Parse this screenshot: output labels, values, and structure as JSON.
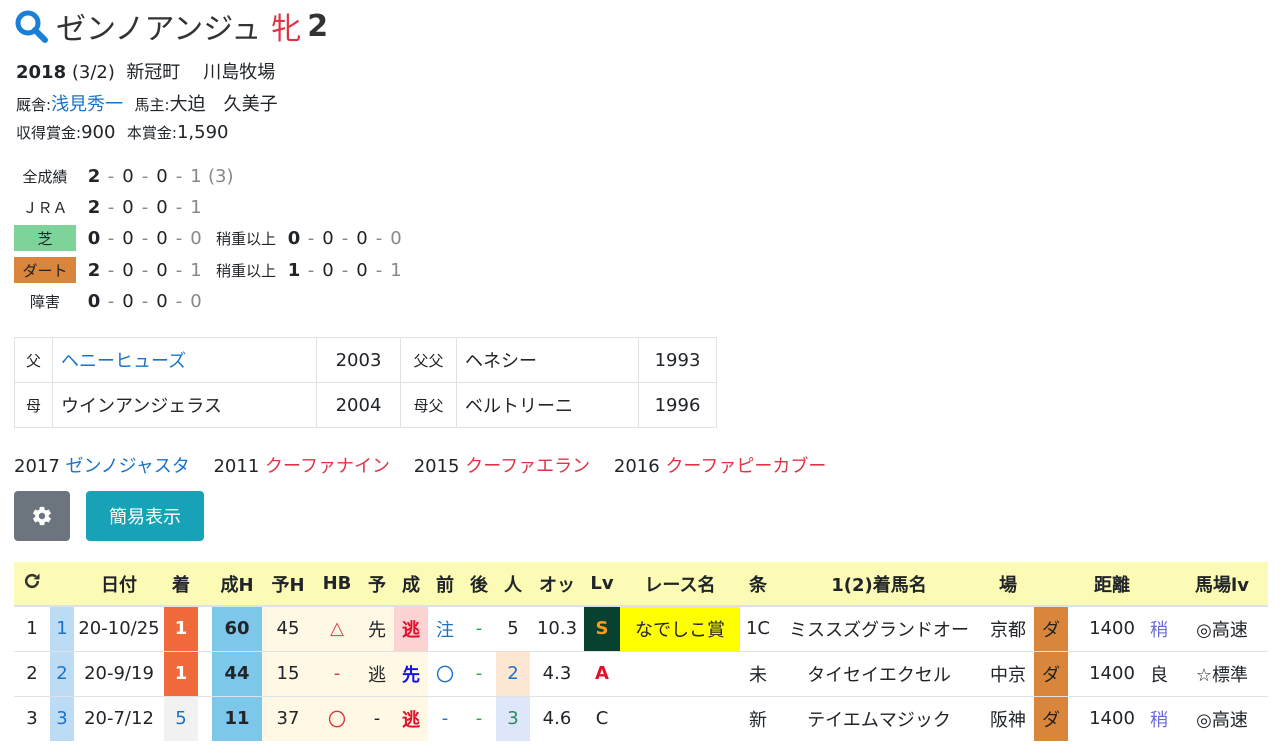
{
  "horse": {
    "name": "ゼンノアンジュ",
    "sex": "牝",
    "age": "2",
    "birth_year": "2018",
    "birth_date": "(3/2)",
    "region": "新冠町",
    "breeder": "川島牧場",
    "trainer_label": "厩舎:",
    "trainer": "浅見秀一",
    "owner_label": "馬主:",
    "owner": "大迫　久美子",
    "earned_label": "収得賞金:",
    "earned": "900",
    "main_prize_label": "本賞金:",
    "main_prize": "1,590"
  },
  "records": [
    {
      "label": "全成績",
      "vals": [
        "2",
        "0",
        "0",
        "1"
      ],
      "extra": "(3)"
    },
    {
      "label": "ＪＲＡ",
      "vals": [
        "2",
        "0",
        "0",
        "1"
      ]
    },
    {
      "label": "芝",
      "vals": [
        "0",
        "0",
        "0",
        "0"
      ],
      "sub_label": "稍重以上",
      "sub_vals": [
        "0",
        "0",
        "0",
        "0"
      ]
    },
    {
      "label": "ダート",
      "vals": [
        "2",
        "0",
        "0",
        "1"
      ],
      "sub_label": "稍重以上",
      "sub_vals": [
        "1",
        "0",
        "0",
        "1"
      ]
    },
    {
      "label": "障害",
      "vals": [
        "0",
        "0",
        "0",
        "0"
      ]
    }
  ],
  "pedigree": {
    "sire_label": "父",
    "sire": "ヘニーヒューズ",
    "sire_year": "2003",
    "sire_sire_label": "父父",
    "sire_sire": "ヘネシー",
    "sire_sire_year": "1993",
    "dam_label": "母",
    "dam": "ウインアンジェラス",
    "dam_year": "2004",
    "dam_sire_label": "母父",
    "dam_sire": "ベルトリーニ",
    "dam_sire_year": "1996"
  },
  "siblings": [
    {
      "year": "2017",
      "name": "ゼンノジャスタ",
      "color": "#1a73c8"
    },
    {
      "year": "2011",
      "name": "クーファナイン",
      "color": "#dc3545"
    },
    {
      "year": "2015",
      "name": "クーファエラン",
      "color": "#dc3545"
    },
    {
      "year": "2016",
      "name": "クーファピーカブー",
      "color": "#dc3545"
    }
  ],
  "buttons": {
    "simple_view": "簡易表示"
  },
  "race_table": {
    "headers": [
      "",
      "",
      "日付",
      "着",
      "",
      "成H",
      "予H",
      "HB",
      "予",
      "成",
      "前",
      "後",
      "人",
      "オッ",
      "Lv",
      "レース名",
      "条",
      "1(2)着馬名",
      "場",
      "",
      "",
      "距離",
      "",
      "馬場lv"
    ],
    "rows": [
      {
        "no": "1",
        "idx": "1",
        "date": "20-10/25",
        "rank": "1",
        "seiH": "60",
        "yoH": "45",
        "hb": "△",
        "yo": "先",
        "sei": "逃",
        "mae": "注",
        "ato": "-",
        "ninki": "5",
        "odds": "10.3",
        "lv": "S",
        "race": "なでしこ賞",
        "cond": "1C",
        "winner": "ミススズグランドオー",
        "place": "京都",
        "track": "ダ",
        "dist": "1400",
        "baba": "稍",
        "babalv": "◎高速"
      },
      {
        "no": "2",
        "idx": "2",
        "date": "20-9/19",
        "rank": "1",
        "seiH": "44",
        "yoH": "15",
        "hb": "-",
        "yo": "逃",
        "sei": "先",
        "mae": "〇",
        "ato": "-",
        "ninki": "2",
        "odds": "4.3",
        "lv": "A",
        "race": "",
        "cond": "未",
        "winner": "タイセイエクセル",
        "place": "中京",
        "track": "ダ",
        "dist": "1400",
        "baba": "良",
        "babalv": "☆標準"
      },
      {
        "no": "3",
        "idx": "3",
        "date": "20-7/12",
        "rank": "5",
        "seiH": "11",
        "yoH": "37",
        "hb": "〇",
        "yo": "-",
        "sei": "逃",
        "mae": "-",
        "ato": "-",
        "ninki": "3",
        "odds": "4.6",
        "lv": "C",
        "race": "",
        "cond": "新",
        "winner": "テイエムマジック",
        "place": "阪神",
        "track": "ダ",
        "dist": "1400",
        "baba": "稍",
        "babalv": "◎高速"
      }
    ]
  }
}
